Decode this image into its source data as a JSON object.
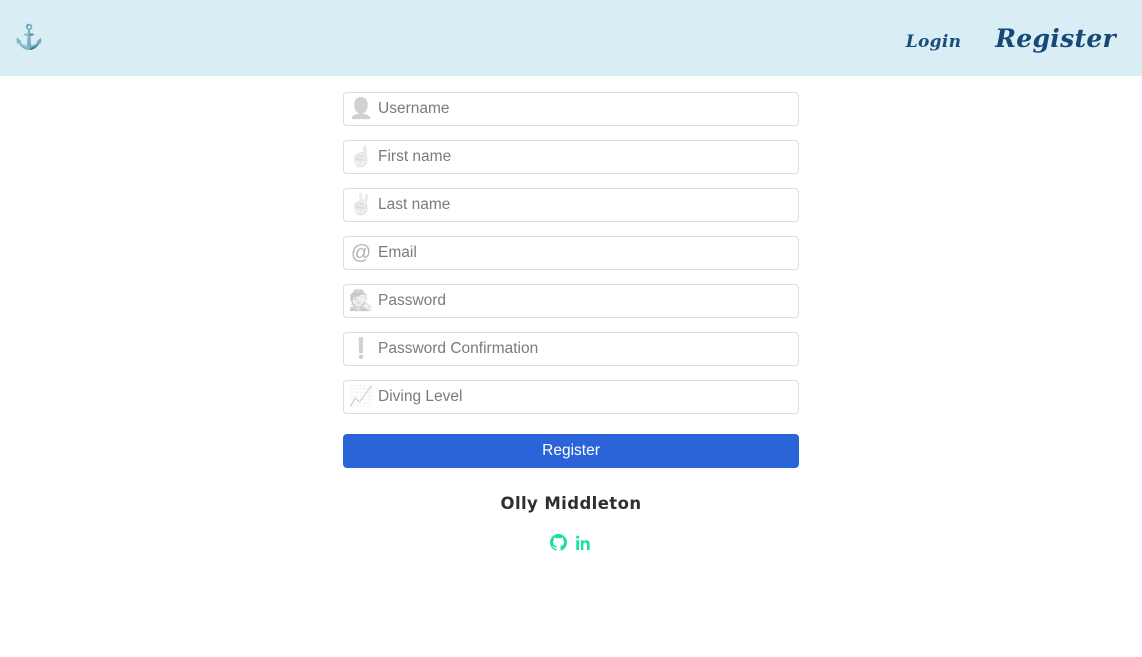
{
  "header": {
    "brand": {
      "icon": "anchor-icon",
      "glyph": "⚓"
    },
    "nav": [
      {
        "name": "login",
        "label": "Login"
      },
      {
        "name": "register",
        "label": "Register"
      }
    ]
  },
  "form": {
    "fields": [
      {
        "name": "username",
        "icon": "person-silhouette-icon",
        "glyph": "👤",
        "placeholder": "Username",
        "value": "",
        "type": "text"
      },
      {
        "name": "first-name",
        "icon": "pointing-up-hand-icon",
        "glyph": "☝",
        "placeholder": "First name",
        "value": "",
        "type": "text"
      },
      {
        "name": "last-name",
        "icon": "victory-hand-icon",
        "glyph": "✌",
        "placeholder": "Last name",
        "value": "",
        "type": "text"
      },
      {
        "name": "email",
        "icon": "at-sign-icon",
        "glyph": "@",
        "placeholder": "Email",
        "value": "",
        "type": "email"
      },
      {
        "name": "password",
        "icon": "detective-icon",
        "glyph": "🕵",
        "placeholder": "Password",
        "value": "",
        "type": "password"
      },
      {
        "name": "password-confirmation",
        "icon": "exclamation-mark-icon",
        "glyph": "❗",
        "placeholder": "Password Confirmation",
        "value": "",
        "type": "password"
      },
      {
        "name": "diving-level",
        "icon": "chart-increasing-icon",
        "glyph": "📈",
        "placeholder": "Diving Level",
        "value": "",
        "type": "text"
      }
    ],
    "submit_label": "Register"
  },
  "footer": {
    "author": "Olly Middleton",
    "social": [
      {
        "name": "github",
        "label": "GitHub"
      },
      {
        "name": "linkedin",
        "label": "LinkedIn"
      }
    ]
  },
  "colors": {
    "header_bg": "#d8eef4",
    "nav_text": "#1a4b7a",
    "primary_button": "#2a64d8",
    "social_icon": "#18e0a0",
    "placeholder": "#7b7b7b",
    "author_text": "#2f2f2f",
    "field_border": "#dedede"
  }
}
